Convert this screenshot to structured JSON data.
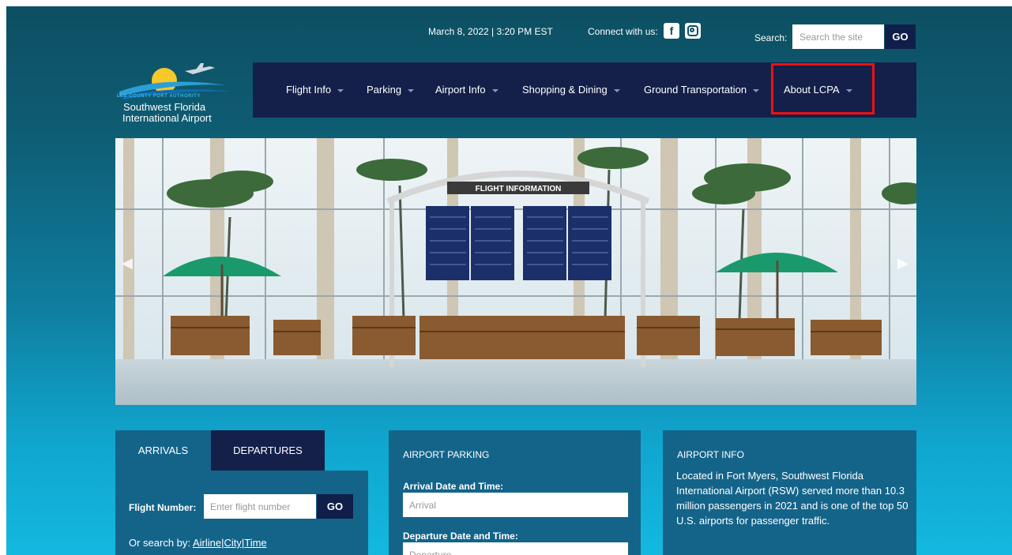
{
  "topbar": {
    "datetime": "March 8, 2022 | 3:20 PM EST",
    "connect_label": "Connect with us:",
    "facebook_icon": "facebook-icon",
    "instagram_icon": "instagram-icon",
    "search_label": "Search:",
    "search_placeholder": "Search the site",
    "search_go": "GO"
  },
  "logo": {
    "authority": "LEE COUNTY PORT AUTHORITY",
    "name_line1": "Southwest Florida",
    "name_line2": "International Airport"
  },
  "nav": {
    "items": [
      {
        "label": "Flight Info"
      },
      {
        "label": "Parking"
      },
      {
        "label": "Airport Info"
      },
      {
        "label": "Shopping & Dining"
      },
      {
        "label": "Ground Transportation"
      },
      {
        "label": "About LCPA"
      }
    ]
  },
  "hero": {
    "sign_text": "FLIGHT INFORMATION"
  },
  "flights": {
    "tabs": [
      "ARRIVALS",
      "DEPARTURES"
    ],
    "flight_number_label": "Flight Number:",
    "flight_number_placeholder": "Enter flight number",
    "go": "GO",
    "or_search": "Or search by:",
    "links": [
      "Airline",
      "City",
      "Time"
    ]
  },
  "parking": {
    "title": "AIRPORT PARKING",
    "arrival_label": "Arrival Date and Time:",
    "arrival_placeholder": "Arrival",
    "departure_label": "Departure Date and Time:",
    "departure_placeholder": "Departure"
  },
  "airport_info": {
    "title": "AIRPORT INFO",
    "text": "Located in Fort Myers, Southwest Florida International Airport (RSW) served more than 10.3 million passengers in 2021 and is one of the top 50 U.S. airports for passenger traffic."
  },
  "colors": {
    "nav_bg": "#14204a",
    "panel_bg": "#14648a",
    "highlight": "#ee1111"
  }
}
